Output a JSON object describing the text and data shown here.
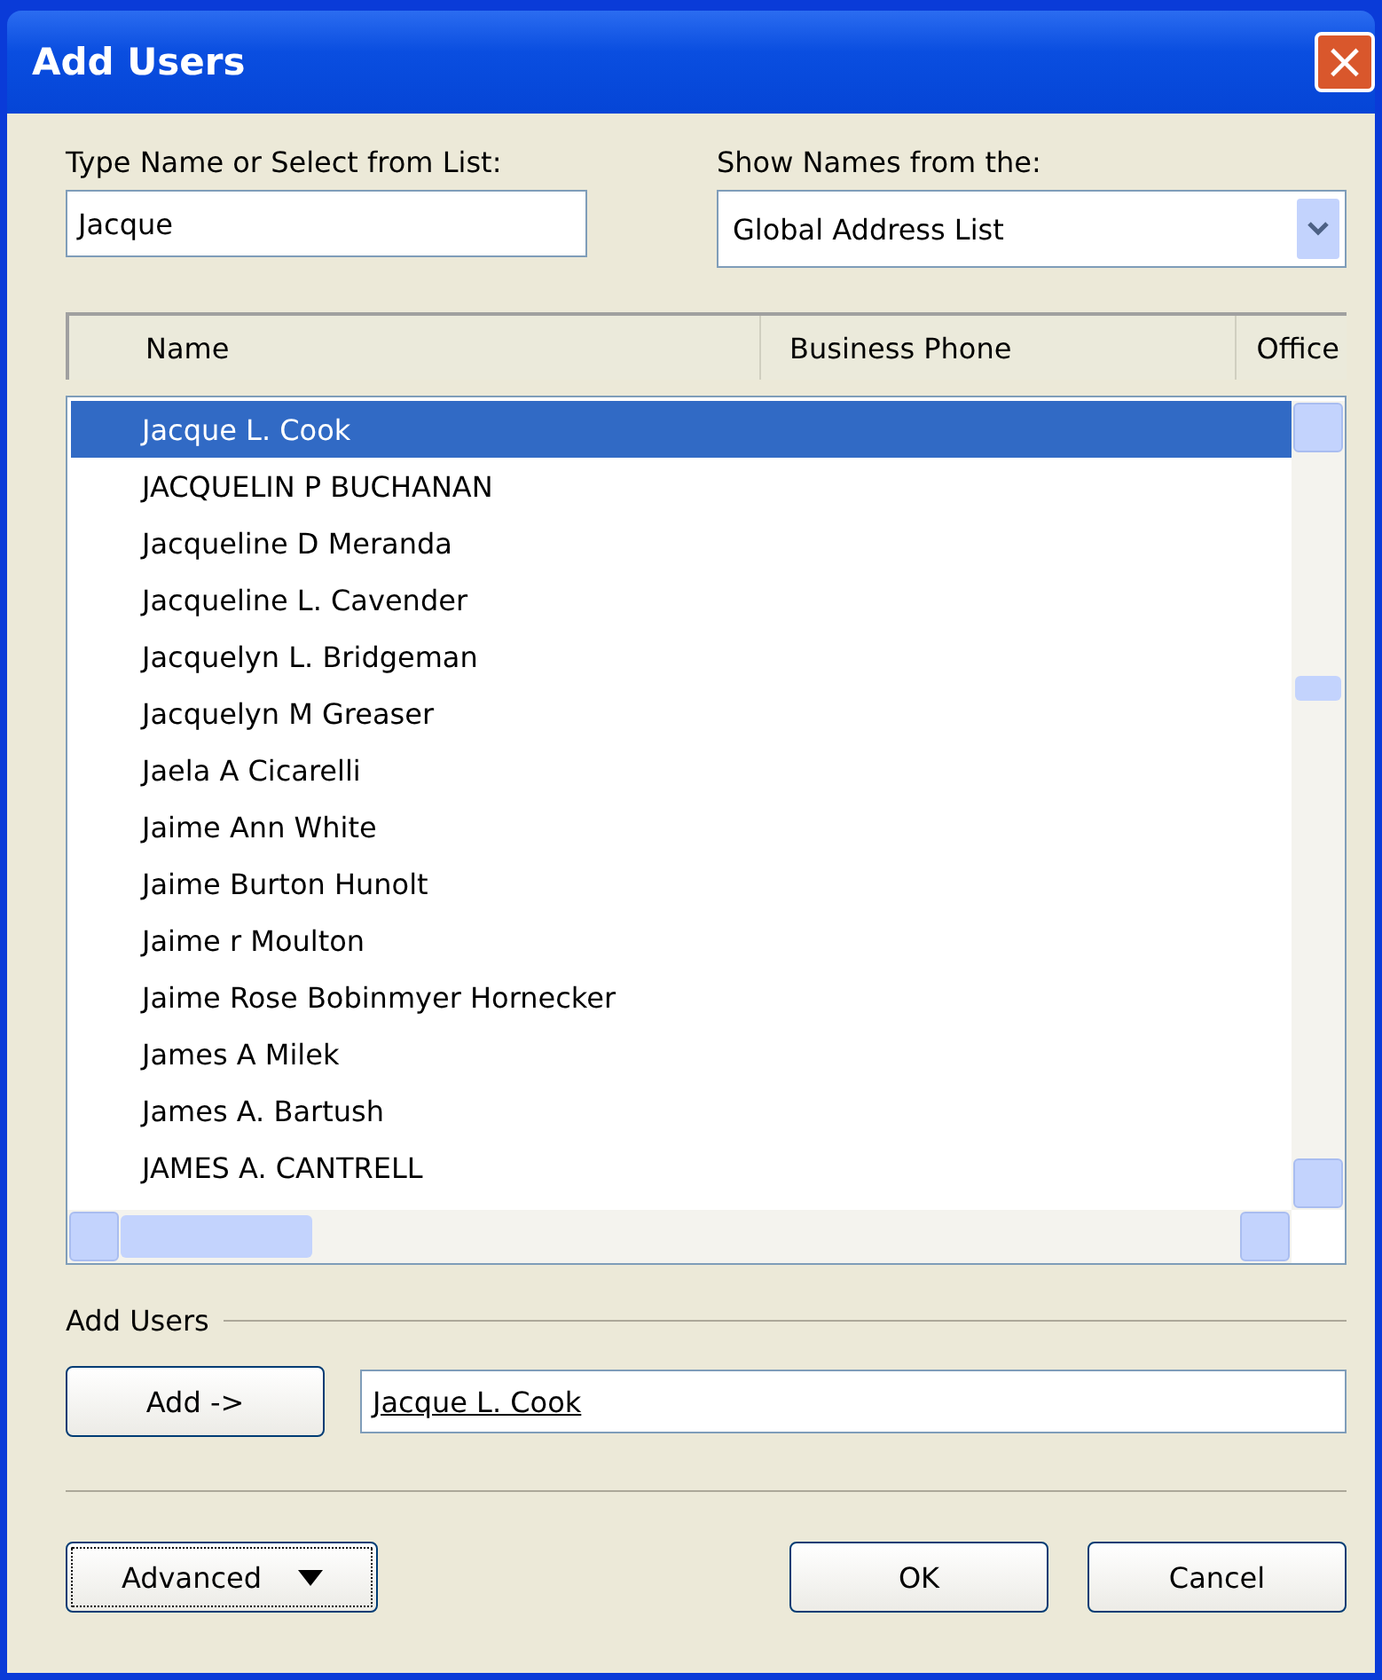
{
  "window": {
    "title": "Add Users",
    "close": "×"
  },
  "name_field": {
    "label": "Type Name or Select from List:",
    "value": "Jacque"
  },
  "source": {
    "label": "Show Names from the:",
    "value": "Global Address List"
  },
  "table": {
    "columns": [
      "Name",
      "Business Phone",
      "Office"
    ],
    "rows": [
      {
        "name": "Jacque L. Cook",
        "selected": true
      },
      {
        "name": "JACQUELIN P BUCHANAN",
        "selected": false
      },
      {
        "name": "Jacqueline D Meranda",
        "selected": false
      },
      {
        "name": "Jacqueline L. Cavender",
        "selected": false
      },
      {
        "name": "Jacquelyn L. Bridgeman",
        "selected": false
      },
      {
        "name": "Jacquelyn M Greaser",
        "selected": false
      },
      {
        "name": "Jaela A Cicarelli",
        "selected": false
      },
      {
        "name": "Jaime Ann White",
        "selected": false
      },
      {
        "name": "Jaime Burton Hunolt",
        "selected": false
      },
      {
        "name": "Jaime r Moulton",
        "selected": false
      },
      {
        "name": "Jaime Rose Bobinmyer Hornecker",
        "selected": false
      },
      {
        "name": "James A Milek",
        "selected": false
      },
      {
        "name": "James A. Bartush",
        "selected": false
      },
      {
        "name": "JAMES A. CANTRELL",
        "selected": false
      }
    ]
  },
  "add_users": {
    "label": "Add Users",
    "button": "Add ->",
    "value": "Jacque L. Cook"
  },
  "buttons": {
    "advanced": "Advanced",
    "ok": "OK",
    "cancel": "Cancel"
  }
}
